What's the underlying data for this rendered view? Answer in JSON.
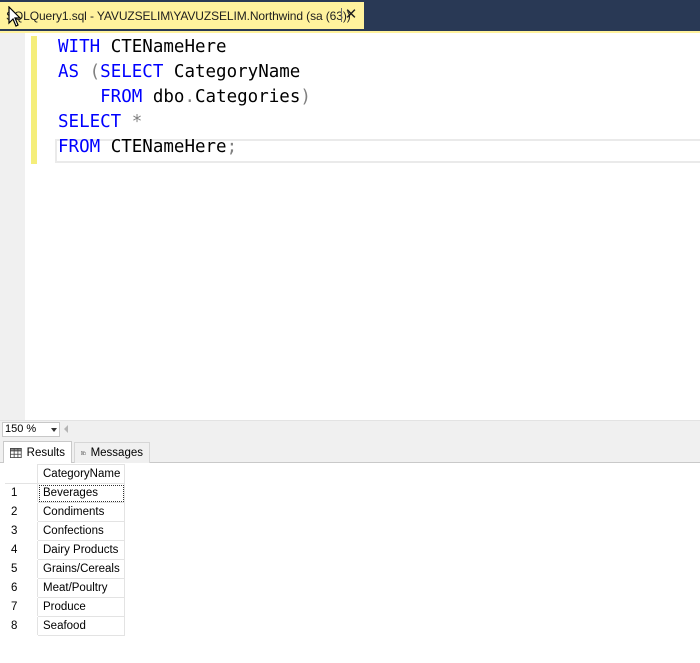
{
  "tab": {
    "title": "SQLQuery1.sql - YAVUZSELIM\\YAVUZSELIM.Northwind (sa (63))",
    "close_glyph": "✕"
  },
  "editor": {
    "lines": [
      {
        "parts": [
          {
            "t": "WITH",
            "c": "kw"
          },
          {
            "t": " CTENameHere",
            "c": ""
          }
        ]
      },
      {
        "parts": [
          {
            "t": "AS",
            "c": "kw"
          },
          {
            "t": " (",
            "c": "gray"
          },
          {
            "t": "SELECT",
            "c": "kw"
          },
          {
            "t": " CategoryName",
            "c": ""
          }
        ]
      },
      {
        "parts": [
          {
            "t": "    FROM",
            "c": "kw"
          },
          {
            "t": " dbo",
            "c": ""
          },
          {
            "t": ".",
            "c": "gray"
          },
          {
            "t": "Categories",
            "c": ""
          },
          {
            "t": ")",
            "c": "gray"
          }
        ]
      },
      {
        "parts": [
          {
            "t": "SELECT",
            "c": "kw"
          },
          {
            "t": " *",
            "c": "gray"
          }
        ]
      },
      {
        "parts": [
          {
            "t": "FROM",
            "c": "kw"
          },
          {
            "t": " CTENameHere",
            "c": ""
          },
          {
            "t": ";",
            "c": "gray"
          }
        ]
      }
    ]
  },
  "zoom": {
    "value": "150 %"
  },
  "results_tabs": {
    "results_label": "Results",
    "messages_label": "Messages"
  },
  "grid": {
    "column_header": "CategoryName",
    "rows": [
      {
        "n": "1",
        "value": "Beverages"
      },
      {
        "n": "2",
        "value": "Condiments"
      },
      {
        "n": "3",
        "value": "Confections"
      },
      {
        "n": "4",
        "value": "Dairy Products"
      },
      {
        "n": "5",
        "value": "Grains/Cereals"
      },
      {
        "n": "6",
        "value": "Meat/Poultry"
      },
      {
        "n": "7",
        "value": "Produce"
      },
      {
        "n": "8",
        "value": "Seafood"
      }
    ]
  },
  "colors": {
    "tab_accent": "#fff29d",
    "tabstrip_bg": "#293955",
    "keyword": "#0000ff",
    "change_bar": "#f5ee7a"
  }
}
